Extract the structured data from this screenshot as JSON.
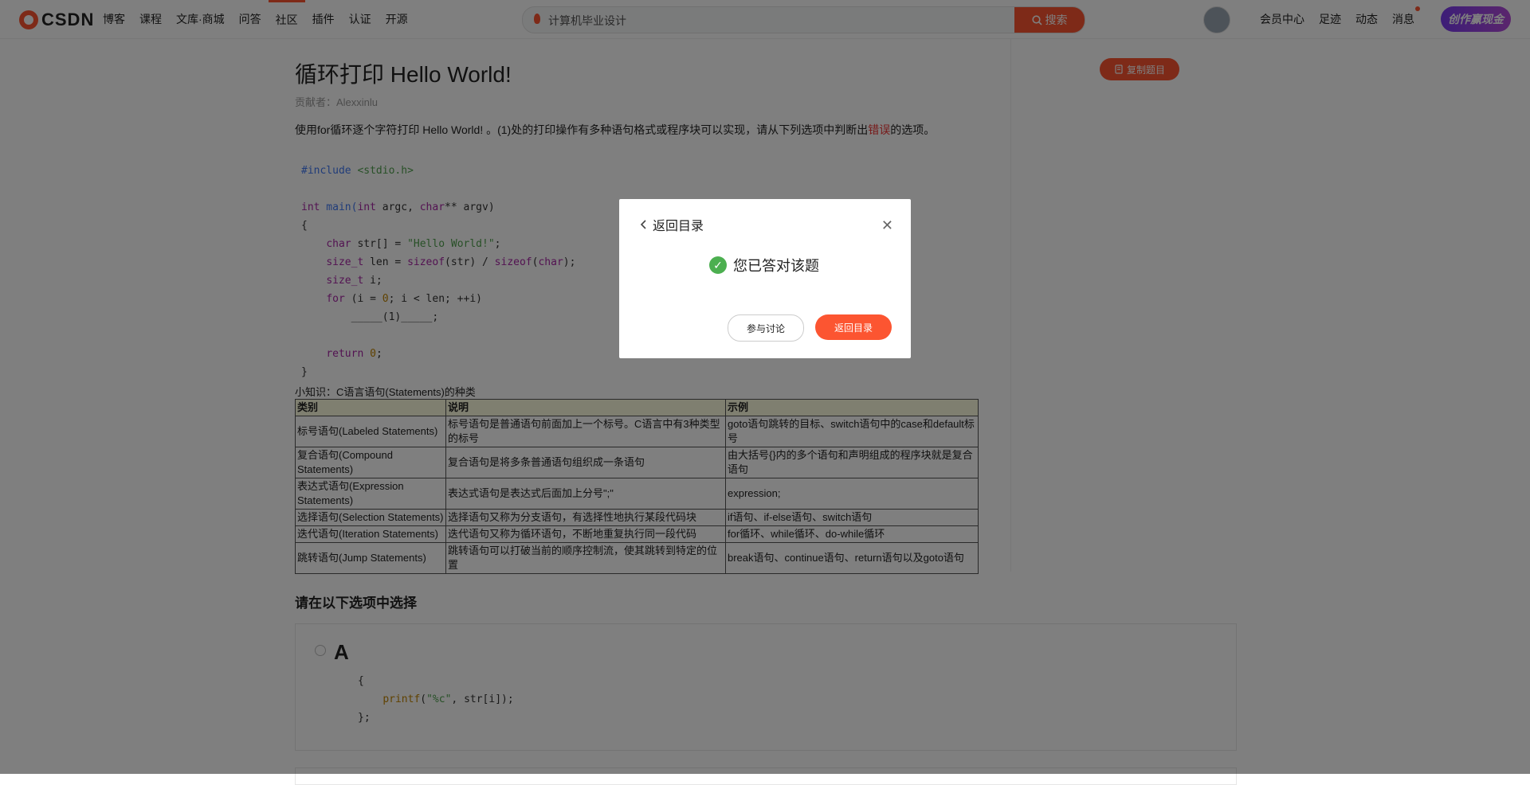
{
  "header": {
    "logo_text": "CSDN",
    "nav": [
      "博客",
      "课程",
      "文库·商城",
      "问答",
      "社区",
      "插件",
      "认证",
      "开源"
    ],
    "search_value": "计算机毕业设计",
    "search_button": "搜索",
    "right_nav": [
      "会员中心",
      "足迹",
      "动态",
      "消息"
    ],
    "create_button": "创作赢现金"
  },
  "question": {
    "title": "循环打印 Hello World!",
    "contributor": "贡献者：Alexxinlu",
    "desc_before": "使用for循环逐个字符打印 Hello World! 。(1)处的打印操作有多种语句格式或程序块可以实现，请从下列选项中判断出",
    "desc_highlight": "错误",
    "desc_after": "的选项。",
    "copy_button": "复制题目"
  },
  "code": {
    "l1_dir": "#include",
    "l1_hdr": " <stdio.h>",
    "l3_int": "int",
    "l3_main": " main(",
    "l3_int2": "int",
    "l3_rest": " argc, ",
    "l3_char": "char",
    "l3_rest2": "** argv)",
    "l4": "{",
    "l5_char": "char",
    "l5_mid": " str[] = ",
    "l5_str": "\"Hello World!\"",
    "l5_end": ";",
    "l6_type": "size_t",
    "l6_a": " len = ",
    "l6_fn1": "sizeof",
    "l6_b": "(str) / ",
    "l6_fn2": "sizeof",
    "l6_c": "(",
    "l6_char": "char",
    "l6_d": ");",
    "l7_type": "size_t",
    "l7_rest": " i;",
    "l8_for": "for",
    "l8_a": " (i = ",
    "l8_zero": "0",
    "l8_b": "; i < len; ++i)",
    "l9": "_____(1)_____;",
    "l11_ret": "return",
    "l11_zero": "0",
    "l11_end": ";",
    "l12": "}"
  },
  "tip": "小知识：C语言语句(Statements)的种类",
  "table": {
    "headers": [
      "类别",
      "说明",
      "示例"
    ],
    "rows": [
      [
        "标号语句(Labeled Statements)",
        "标号语句是普通语句前面加上一个标号。C语言中有3种类型的标号",
        "goto语句跳转的目标、switch语句中的case和default标号"
      ],
      [
        "复合语句(Compound Statements)",
        "复合语句是将多条普通语句组织成一条语句",
        "由大括号{}内的多个语句和声明组成的程序块就是复合语句"
      ],
      [
        "表达式语句(Expression Statements)",
        "表达式语句是表达式后面加上分号\";\"",
        "expression;"
      ],
      [
        "选择语句(Selection Statements)",
        "选择语句又称为分支语句，有选择性地执行某段代码块",
        "if语句、if-else语句、switch语句"
      ],
      [
        "迭代语句(Iteration Statements)",
        "迭代语句又称为循环语句，不断地重复执行同一段代码",
        "for循环、while循环、do-while循环"
      ],
      [
        "跳转语句(Jump Statements)",
        "跳转语句可以打破当前的顺序控制流，使其跳转到特定的位置",
        "break语句、continue语句、return语句以及goto语句"
      ]
    ]
  },
  "choose_label": "请在以下选项中选择",
  "option_a": {
    "letter": "A",
    "l1": "{",
    "l2_fn": "printf",
    "l2_a": "(",
    "l2_str": "\"%c\"",
    "l2_b": ", str[i]);",
    "l3": "};"
  },
  "modal": {
    "back_label": "返回目录",
    "message": "您已答对该题",
    "discuss_button": "参与讨论",
    "back_button": "返回目录"
  },
  "colors": {
    "brand": "#fc5531",
    "success": "#4caf50"
  }
}
